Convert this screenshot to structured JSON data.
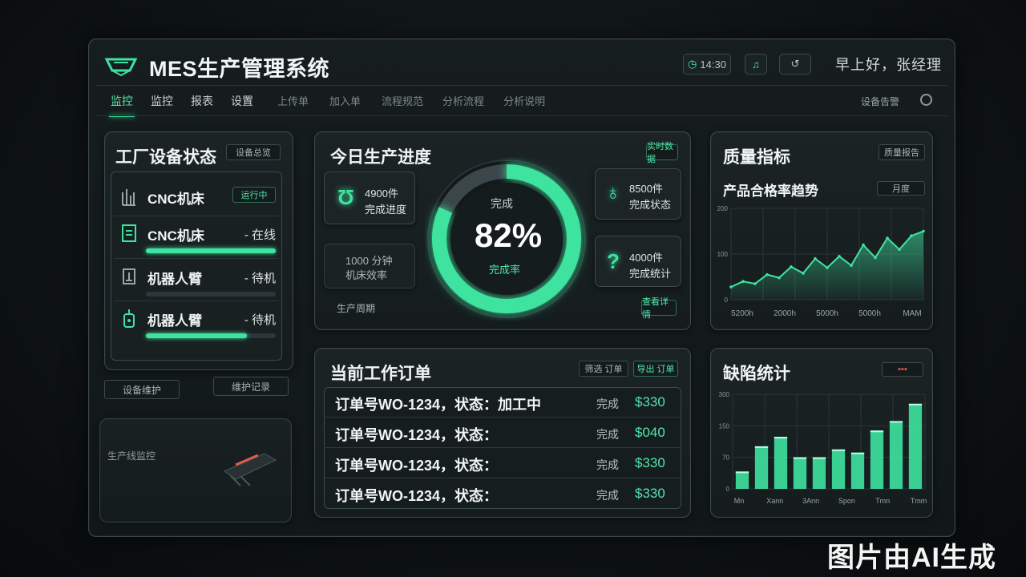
{
  "header": {
    "title": "MES生产管理系统",
    "time": "14:30",
    "right_text": "早上好，张经理"
  },
  "nav": {
    "items": [
      "监控",
      "监控",
      "报表",
      "设置",
      "上传单",
      "加入单",
      "流程规范",
      "分析流程",
      "分析说明"
    ],
    "right_text": "设备告警"
  },
  "equipment": {
    "title": "工厂设备状态",
    "tag": "设备总览",
    "rows": [
      {
        "name": "CNC机床",
        "status": "",
        "tag": "运行中",
        "progress": 0
      },
      {
        "name": "CNC机床",
        "status": "- 在线",
        "progress": 1.0
      },
      {
        "name": "机器人臂",
        "status": "- 待机",
        "progress": 0
      },
      {
        "name": "机器人臂",
        "status": "- 待机",
        "progress": 0.78
      }
    ],
    "footer_left": "设备维护",
    "footer_right": "维护记录"
  },
  "lower_left": {
    "label": "生产线监控"
  },
  "production": {
    "title": "今日生产进度",
    "tag": "实时数据",
    "percent": "82%",
    "percent_value": 0.82,
    "center_top": "完成",
    "center_bottom": "完成率",
    "cards": [
      {
        "line1": "4900件",
        "line2": "完成进度"
      },
      {
        "line1": "8500件",
        "line2": "完成状态"
      },
      {
        "line1": "1000 分钟",
        "line2": "机床效率"
      },
      {
        "line1": "4000件",
        "line2": "完成统计"
      }
    ],
    "footer_text": "生产周期",
    "footer_tag": "查看详情"
  },
  "orders": {
    "title": "当前工作订单",
    "tag1": "筛选 订单",
    "tag2": "导出 订单",
    "rows": [
      {
        "text": "订单号WO-1234，状态：加工中",
        "mid": "完成",
        "value": "$330"
      },
      {
        "text": "订单号WO-1234，状态：",
        "mid": "完成",
        "value": "$040"
      },
      {
        "text": "订单号WO-1234，状态：",
        "mid": "完成",
        "value": "$330"
      },
      {
        "text": "订单号WO-1234，状态：",
        "mid": "完成",
        "value": "$330"
      }
    ]
  },
  "quality": {
    "title": "质量指标",
    "tag": "质量报告",
    "subtitle": "产品合格率趋势",
    "subtag": "月度"
  },
  "defects": {
    "title": "缺陷统计"
  },
  "chart_data": [
    {
      "type": "line",
      "title": "产品合格率趋势",
      "x": [
        "5200h",
        "2000h",
        "5000h",
        "5000h",
        "MAM"
      ],
      "ylabels": [
        "200",
        "100",
        "0"
      ],
      "ylim": [
        0,
        200
      ],
      "values": [
        28,
        40,
        35,
        55,
        48,
        72,
        58,
        90,
        70,
        95,
        75,
        120,
        92,
        135,
        110,
        140,
        150
      ],
      "color": "#3fe3a0",
      "grid": true
    },
    {
      "type": "bar",
      "title": "缺陷统计",
      "categories": [
        "Mn",
        "Xann",
        "3Ann",
        "Spon",
        "Tmn",
        "Tmm"
      ],
      "ylabels": [
        "300",
        "150",
        "70",
        "0"
      ],
      "ylim": [
        0,
        300
      ],
      "values": [
        55,
        135,
        165,
        100,
        100,
        125,
        115,
        185,
        215,
        270
      ],
      "color": "#3fe3a0"
    }
  ],
  "watermark": "图片由AI生成"
}
